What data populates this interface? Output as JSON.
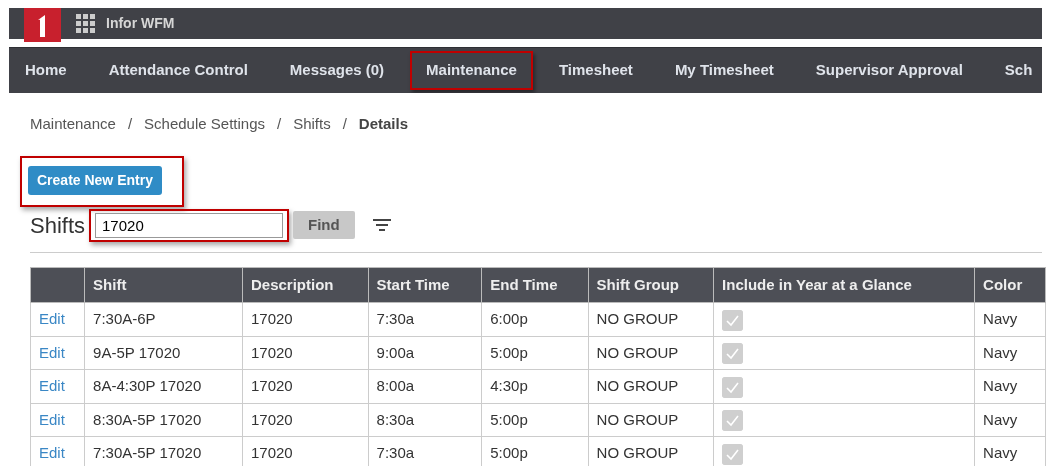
{
  "app": {
    "title": "Infor WFM"
  },
  "nav": [
    {
      "label": "Home",
      "highlighted": false
    },
    {
      "label": "Attendance Control",
      "highlighted": false
    },
    {
      "label": "Messages (0)",
      "highlighted": false
    },
    {
      "label": "Maintenance",
      "highlighted": true
    },
    {
      "label": "Timesheet",
      "highlighted": false
    },
    {
      "label": "My Timesheet",
      "highlighted": false
    },
    {
      "label": "Supervisor Approval",
      "highlighted": false
    },
    {
      "label": "Sch",
      "highlighted": false
    }
  ],
  "breadcrumb": [
    {
      "label": "Maintenance",
      "current": false,
      "separator": "/"
    },
    {
      "label": "Schedule Settings",
      "current": false,
      "separator": "/"
    },
    {
      "label": "Shifts",
      "current": false,
      "separator": "/"
    },
    {
      "label": "Details",
      "current": true
    }
  ],
  "create_button": {
    "label": "Create New Entry",
    "highlighted": true
  },
  "search": {
    "title": "Shifts",
    "value": "17020",
    "highlighted": true,
    "button": "Find"
  },
  "table": {
    "columns": [
      "Shift",
      "Description",
      "Start Time",
      "End Time",
      "Shift Group",
      "Include in Year at a Glance",
      "Color"
    ],
    "rows": [
      {
        "action": "Edit",
        "shift": "7:30A-6P",
        "description": "17020",
        "start": "7:30a",
        "end": "6:00p",
        "group": "NO GROUP",
        "include": true,
        "color_name": "Navy"
      },
      {
        "action": "Edit",
        "shift": "9A-5P 17020",
        "description": "17020",
        "start": "9:00a",
        "end": "5:00p",
        "group": "NO GROUP",
        "include": true,
        "color_name": "Navy"
      },
      {
        "action": "Edit",
        "shift": "8A-4:30P 17020",
        "description": "17020",
        "start": "8:00a",
        "end": "4:30p",
        "group": "NO GROUP",
        "include": true,
        "color_name": "Navy"
      },
      {
        "action": "Edit",
        "shift": "8:30A-5P 17020",
        "description": "17020",
        "start": "8:30a",
        "end": "5:00p",
        "group": "NO GROUP",
        "include": true,
        "color_name": "Navy"
      },
      {
        "action": "Edit",
        "shift": "7:30A-5P 17020",
        "description": "17020",
        "start": "7:30a",
        "end": "5:00p",
        "group": "NO GROUP",
        "include": true,
        "color_name": "Navy"
      }
    ]
  }
}
